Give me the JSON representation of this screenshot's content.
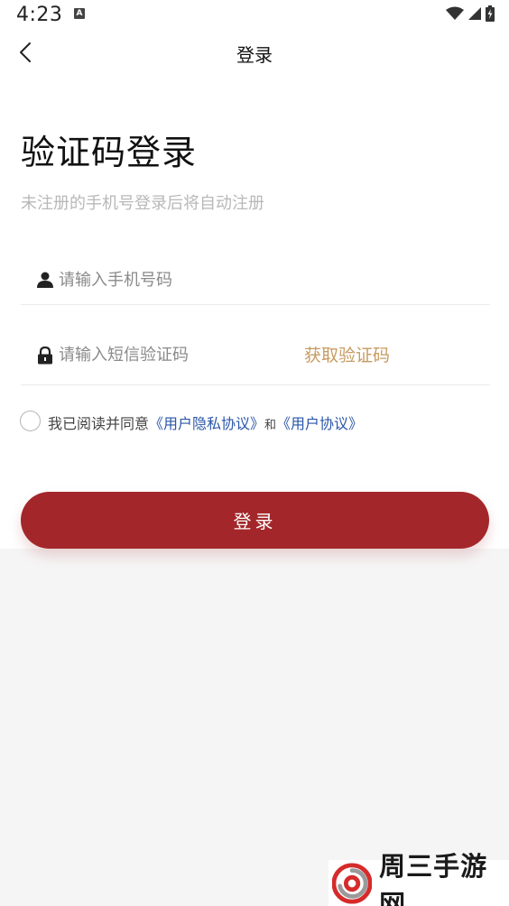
{
  "status_bar": {
    "time": "4:23",
    "notification_badge": "A",
    "icons": [
      "wifi-icon",
      "cellular-signal-icon",
      "battery-charging-icon"
    ]
  },
  "header": {
    "title": "登录",
    "back_icon": "chevron-left-icon"
  },
  "main": {
    "heading": "验证码登录",
    "subtitle": "未注册的手机号登录后将自动注册",
    "phone_field": {
      "icon": "user-icon",
      "placeholder": "请输入手机号码",
      "value": ""
    },
    "code_field": {
      "icon": "lock-icon",
      "placeholder": "请输入短信验证码",
      "value": "",
      "get_code_label": "获取验证码"
    },
    "agreement": {
      "checked": false,
      "prefix": "我已阅读并同意",
      "privacy_link": "《用户隐私协议》",
      "and": "和",
      "user_link": "《用户协议》"
    },
    "login_button_label": "登录"
  },
  "watermark": {
    "text": "周三手游网"
  },
  "colors": {
    "primary": "#a3272a",
    "accent": "#c69b60",
    "link": "#2a55a8",
    "background": "#f5f5f5"
  }
}
